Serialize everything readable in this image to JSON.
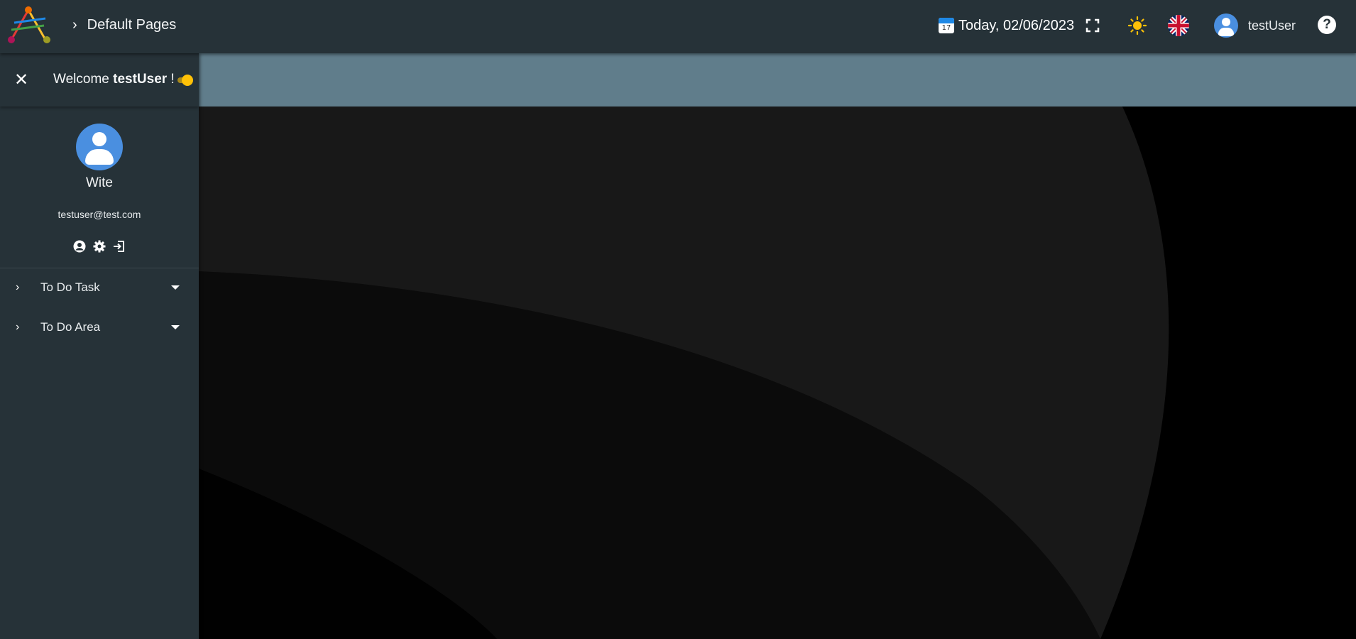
{
  "header": {
    "breadcrumb": "Default Pages",
    "date_text": "Today, 02/06/2023",
    "calendar_day": "17",
    "user_name": "testUser",
    "help_symbol": "?"
  },
  "sidebar": {
    "welcome_prefix": "Welcome ",
    "welcome_user": "testUser",
    "welcome_suffix": " !",
    "profile_name": "Wite",
    "profile_email": "testuser@test.com",
    "nav_items": [
      {
        "label": "To Do Task"
      },
      {
        "label": "To Do Area"
      }
    ]
  },
  "colors": {
    "topbar": "#263238",
    "content_band": "#607d8b",
    "accent_yellow": "#ffc107",
    "avatar_blue": "#4a8fe0"
  },
  "icons": {
    "theme": "sun-icon",
    "language": "uk-flag-icon",
    "fullscreen": "fullscreen-icon",
    "profile": "account-circle-icon",
    "settings": "gear-icon",
    "logout": "logout-icon"
  }
}
